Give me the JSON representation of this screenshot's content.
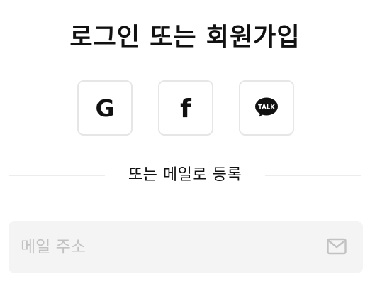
{
  "auth": {
    "title": "로그인 또는 회원가입",
    "divider_text": "또는 메일로 등록",
    "social": {
      "google": {
        "icon": "google-icon",
        "letter": "G"
      },
      "facebook": {
        "icon": "facebook-icon",
        "letter": "f"
      },
      "kakao": {
        "icon": "kakao-talk-icon",
        "label": "TALK"
      }
    },
    "email": {
      "placeholder": "메일 주소",
      "value": "",
      "icon": "mail-icon"
    }
  },
  "colors": {
    "text": "#111111",
    "border": "#e6e6e6",
    "field_bg": "#f4f4f4",
    "placeholder": "#c2c2c2",
    "divider": "#ececec"
  }
}
